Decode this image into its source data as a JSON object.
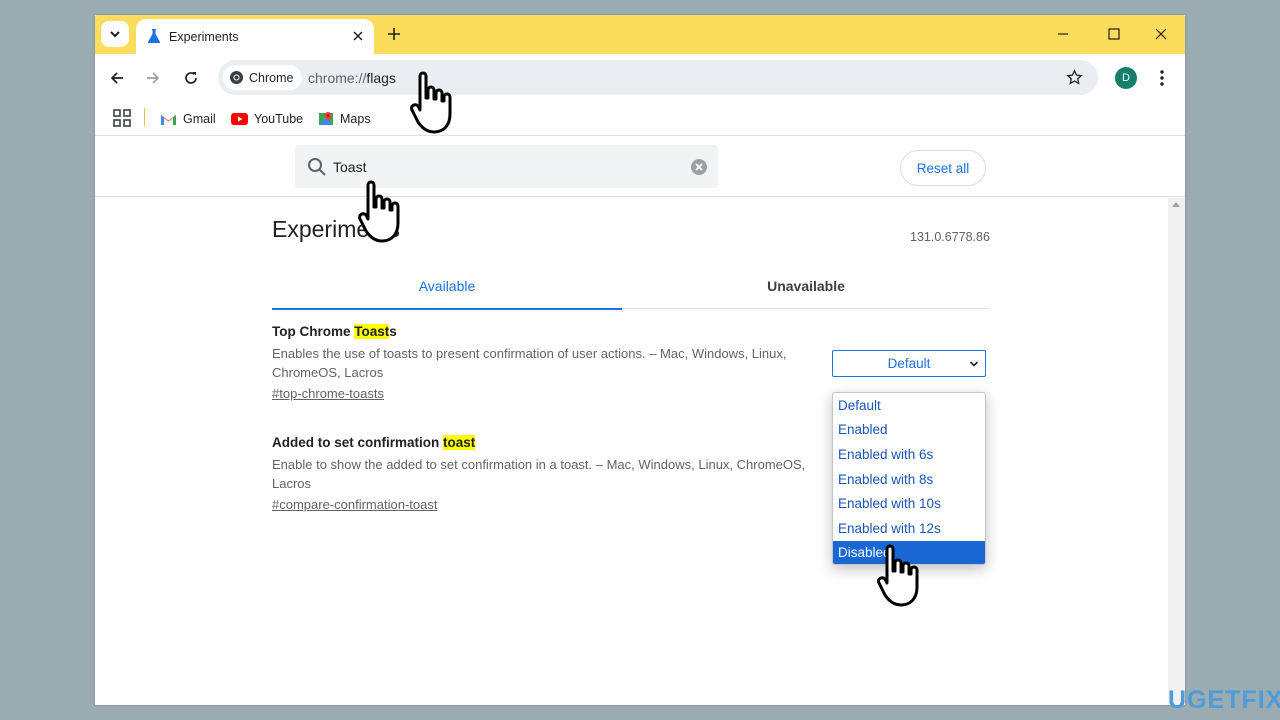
{
  "tab": {
    "title": "Experiments"
  },
  "omnibox": {
    "chip_label": "Chrome",
    "url_scheme": "chrome://",
    "url_path": "flags"
  },
  "profile": {
    "initial": "D"
  },
  "bookmarks": [
    {
      "label": "Gmail"
    },
    {
      "label": "YouTube"
    },
    {
      "label": "Maps"
    }
  ],
  "search": {
    "value": "Toast"
  },
  "reset_label": "Reset all",
  "page": {
    "heading": "Experiments",
    "version": "131.0.6778.86",
    "tabs": {
      "available": "Available",
      "unavailable": "Unavailable"
    }
  },
  "flags": [
    {
      "title_prefix": "Top Chrome ",
      "title_highlight": "Toast",
      "title_suffix": "s",
      "description": "Enables the use of toasts to present confirmation of user actions. – Mac, Windows, Linux, ChromeOS, Lacros",
      "link": "#top-chrome-toasts",
      "select_value": "Default"
    },
    {
      "title_prefix": "Added to set confirmation ",
      "title_highlight": "toast",
      "title_suffix": "",
      "description": "Enable to show the added to set confirmation in a toast. – Mac, Windows, Linux, ChromeOS, Lacros",
      "link": "#compare-confirmation-toast"
    }
  ],
  "dropdown": {
    "options": [
      "Default",
      "Enabled",
      "Enabled with 6s",
      "Enabled with 8s",
      "Enabled with 10s",
      "Enabled with 12s",
      "Disabled"
    ],
    "highlighted": "Disabled"
  },
  "watermark": "UGETFIX",
  "colors": {
    "titlebar": "#fcdc5c",
    "accent": "#1a73e8",
    "highlight": "#ffff00",
    "selected_option": "#1967d2"
  }
}
